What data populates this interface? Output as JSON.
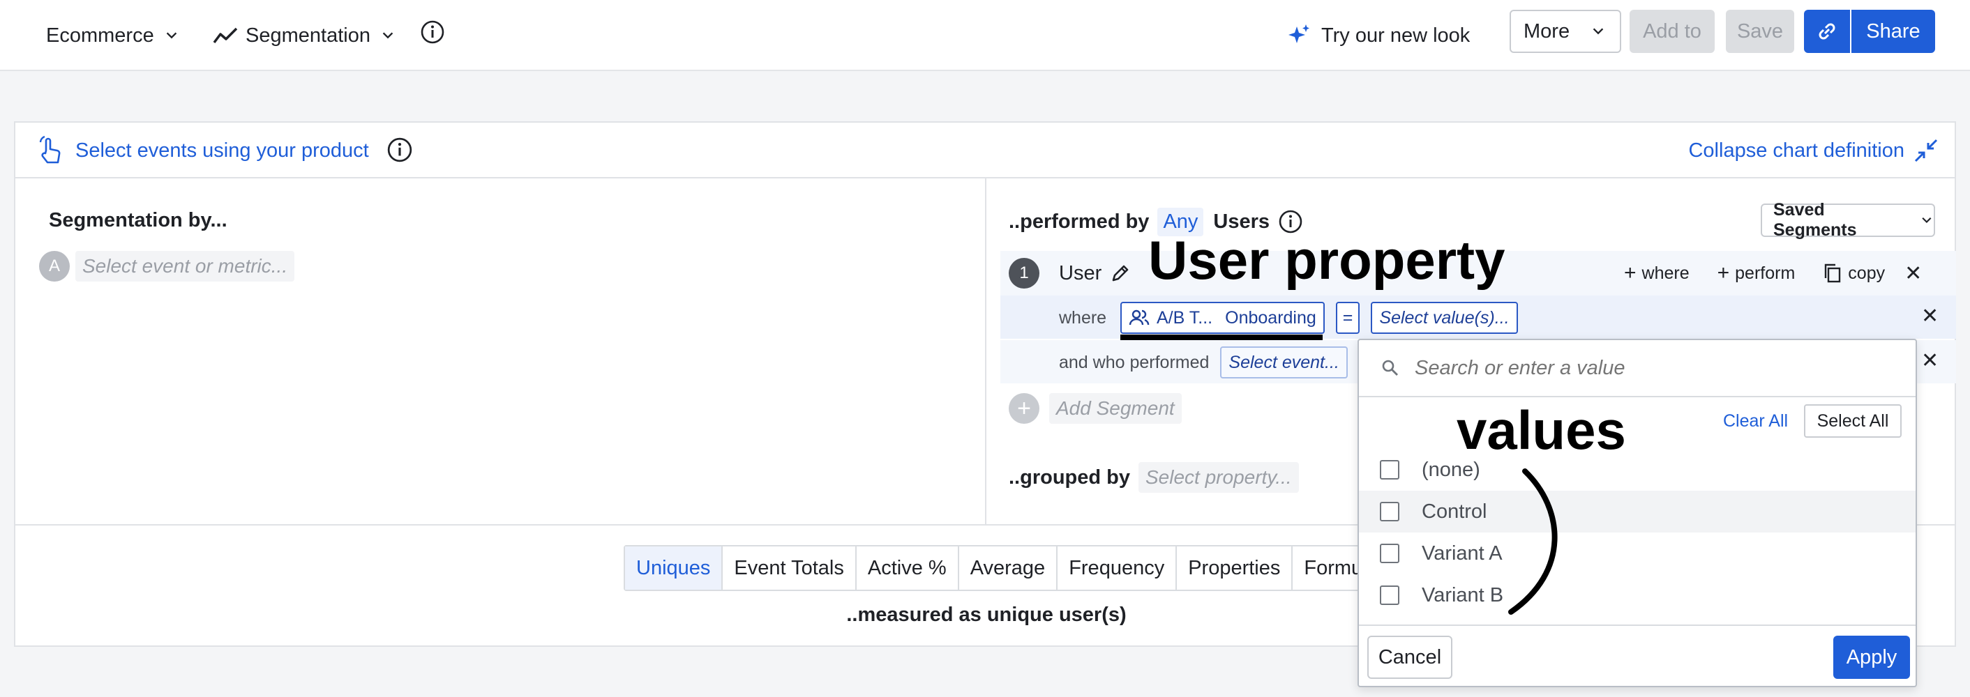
{
  "topbar": {
    "project": "Ecommerce",
    "chart_type": "Segmentation",
    "try_new_look": "Try our new look",
    "more": "More",
    "add_to": "Add to",
    "save": "Save",
    "share": "Share"
  },
  "panel": {
    "select_events_link": "Select events using your product",
    "collapse": "Collapse chart definition",
    "left": {
      "heading": "Segmentation by...",
      "badge": "A",
      "event_placeholder": "Select event or metric..."
    },
    "right": {
      "performed_by": "..performed by",
      "any": "Any",
      "users": "Users",
      "saved_segments": "Saved Segments",
      "segment_number": "1",
      "segment_name": "User",
      "add_where": "where",
      "add_perform": "perform",
      "copy": "copy",
      "where_label": "where",
      "property_token_a": "A/B T...",
      "property_token_b": "Onboarding",
      "operator": "=",
      "value_placeholder": "Select value(s)...",
      "and_who_performed": "and who performed",
      "select_event": "Select event...",
      "add_segment": "Add Segment",
      "grouped_by": "..grouped by",
      "select_property": "Select property..."
    },
    "metrics": {
      "tabs": [
        "Uniques",
        "Event Totals",
        "Active %",
        "Average",
        "Frequency",
        "Properties",
        "Formula"
      ],
      "active": "Uniques",
      "measured_as": "..measured as unique user(s)"
    }
  },
  "dropdown": {
    "search_placeholder": "Search or enter a value",
    "clear_all": "Clear All",
    "select_all": "Select All",
    "options": [
      "(none)",
      "Control",
      "Variant A",
      "Variant B"
    ],
    "cancel": "Cancel",
    "apply": "Apply"
  },
  "annotations": {
    "user_property": "User property",
    "values": "values"
  },
  "colors": {
    "primary": "#1f5ed8",
    "token_border": "#2b58c4",
    "disabled_bg": "#dcdee1"
  }
}
